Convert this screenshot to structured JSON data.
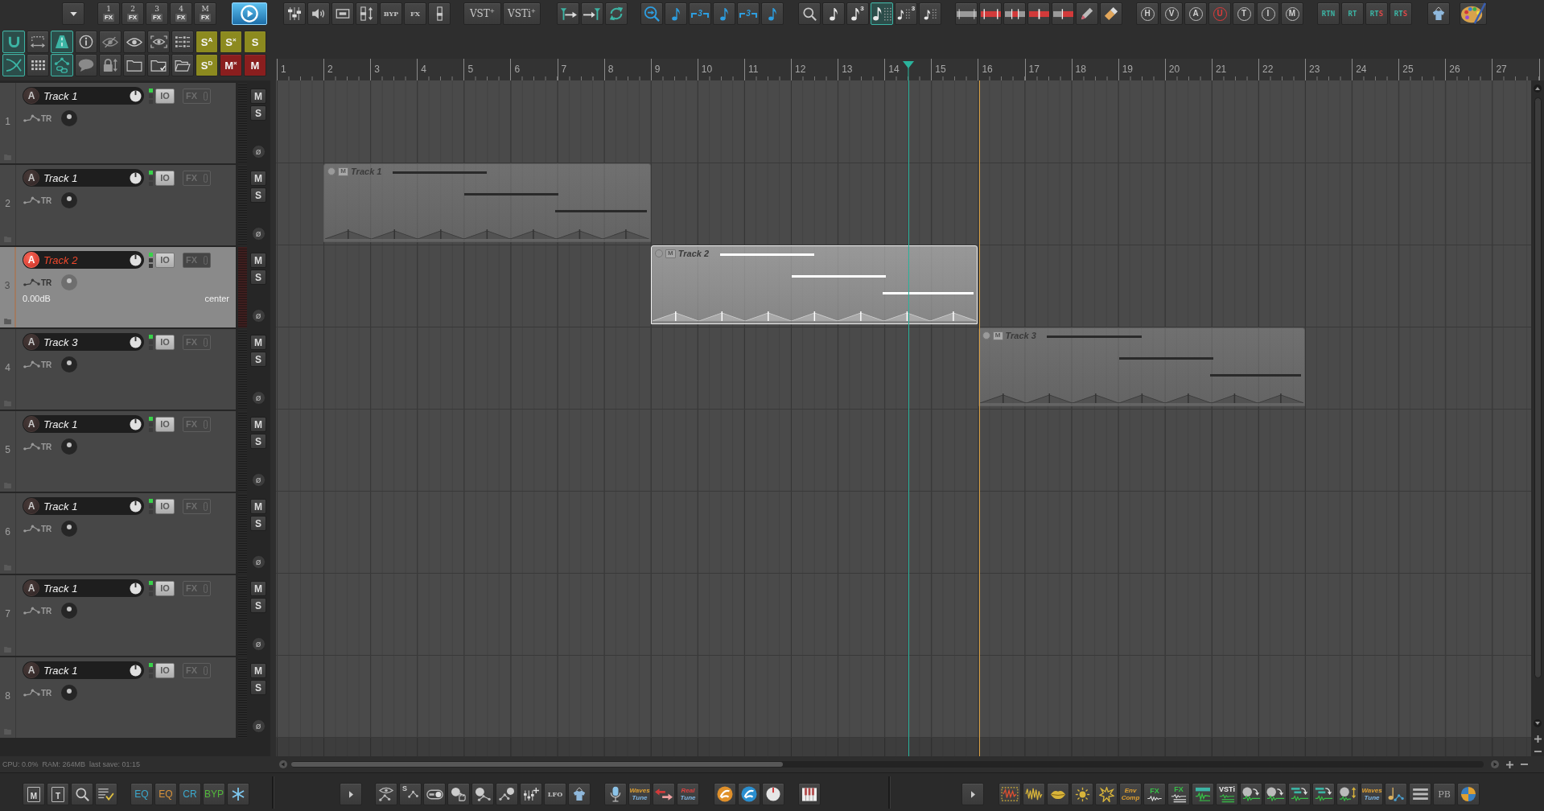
{
  "main_toolbar": {
    "groups": [
      [
        {
          "on": false
        }
      ],
      [
        {
          "number": "1",
          "label": "FX",
          "on": false
        },
        {
          "number": "2",
          "label": "FX",
          "on": false
        },
        {
          "number": "3",
          "label": "FX",
          "on": false
        },
        {
          "number": "4",
          "label": "FX",
          "on": false
        },
        {
          "number": "M",
          "label": "FX",
          "on": false
        }
      ],
      [
        {
          "on": true
        }
      ],
      [
        {
          "on": false
        },
        {
          "on": false
        },
        {
          "on": false
        },
        {
          "on": false
        },
        {
          "label": "BYP",
          "on": false
        },
        {
          "label": "FX",
          "on": false
        },
        {
          "on": false
        }
      ],
      [
        {
          "label": "VST$^{+}$",
          "on": false
        },
        {
          "label": "VSTi$^{+}$",
          "on": false
        }
      ],
      [
        {
          "on": false
        },
        {
          "on": false
        },
        {
          "on": false
        }
      ],
      [
        {
          "on": false
        },
        {
          "on": false
        },
        {
          "label": "3",
          "on": false
        },
        {
          "on": false
        },
        {
          "label": "3",
          "on": false
        },
        {
          "on": false
        }
      ],
      [
        {
          "on": false
        },
        {
          "on": false
        },
        {
          "label": "3",
          "on": false
        },
        {
          "on": true
        },
        {
          "label": "3",
          "on": false
        },
        {
          "on": false
        }
      ],
      [
        {
          "on": false
        },
        {
          "on": false
        },
        {
          "on": false
        },
        {
          "on": false
        },
        {
          "on": false
        },
        {
          "on": false
        },
        {
          "on": false
        }
      ],
      [
        {
          "label": "H",
          "on": false
        },
        {
          "label": "V",
          "on": false
        },
        {
          "label": "A",
          "on": false
        },
        {
          "label": "U",
          "on": true
        },
        {
          "label": "T",
          "on": false
        },
        {
          "label": "I",
          "on": false
        },
        {
          "label": "M",
          "on": false
        }
      ],
      [
        {
          "label": "RTN",
          "on": false
        },
        {
          "label": "RT",
          "on": false
        },
        {
          "label": "RT",
          "suffix": "S",
          "on": false
        },
        {
          "label": "RT",
          "suffix": "S",
          "on": false
        }
      ],
      [
        {
          "on": false
        }
      ],
      [
        {
          "on": false
        }
      ]
    ]
  },
  "left_toolbar": {
    "rows": [
      [
        {
          "on": true
        },
        {
          "on": false
        },
        {
          "on": true
        },
        {
          "on": false
        },
        {
          "on": false
        },
        {
          "on": false
        },
        {
          "on": false
        },
        {
          "on": false
        },
        {
          "label": "S$^{A}$",
          "color": "#8c8a1f",
          "on": false
        },
        {
          "label": "S$^{×}$",
          "color": "#8c8a1f",
          "on": false
        },
        {
          "label": "S",
          "color": "#8c8a1f",
          "on": false
        }
      ],
      [
        {
          "on": true
        },
        {
          "on": false
        },
        {
          "on": true
        },
        {
          "on": false
        },
        {
          "on": false
        },
        {
          "on": false
        },
        {
          "on": false
        },
        {
          "on": false
        },
        {
          "label": "S$^{D}$",
          "color": "#8c8a1f",
          "on": false
        },
        {
          "label": "M$^{×}$",
          "color": "#8a1e1e",
          "on": false
        },
        {
          "label": "M",
          "color": "#8a1e1e",
          "on": false
        }
      ]
    ]
  },
  "ruler": {
    "bars": [
      "1",
      "2",
      "3",
      "4",
      "5",
      "6",
      "7",
      "8",
      "9",
      "10",
      "11",
      "12",
      "13",
      "14",
      "15",
      "16",
      "17",
      "18",
      "19",
      "20",
      "21",
      "22",
      "23",
      "24",
      "25",
      "26",
      "27"
    ]
  },
  "tracks": [
    {
      "number": "1",
      "arm": "A",
      "name": "Track 1",
      "io": "IO",
      "fx": "FX",
      "envelope": "TR",
      "mute": "M",
      "solo": "S",
      "phase": "ø",
      "selected": false,
      "armed": false
    },
    {
      "number": "2",
      "arm": "A",
      "name": "Track 1",
      "io": "IO",
      "fx": "FX",
      "envelope": "TR",
      "mute": "M",
      "solo": "S",
      "phase": "ø",
      "selected": false,
      "armed": false
    },
    {
      "number": "3",
      "arm": "A",
      "name": "Track 2",
      "io": "IO",
      "fx": "FX",
      "envelope": "TR",
      "volume": "0.00dB",
      "pan": "center",
      "mute": "M",
      "solo": "S",
      "phase": "ø",
      "selected": true,
      "armed": true
    },
    {
      "number": "4",
      "arm": "A",
      "name": "Track 3",
      "io": "IO",
      "fx": "FX",
      "envelope": "TR",
      "mute": "M",
      "solo": "S",
      "phase": "ø",
      "selected": false,
      "armed": false
    },
    {
      "number": "5",
      "arm": "A",
      "name": "Track 1",
      "io": "IO",
      "fx": "FX",
      "envelope": "TR",
      "mute": "M",
      "solo": "S",
      "phase": "ø",
      "selected": false,
      "armed": false
    },
    {
      "number": "6",
      "arm": "A",
      "name": "Track 1",
      "io": "IO",
      "fx": "FX",
      "envelope": "TR",
      "mute": "M",
      "solo": "S",
      "phase": "ø",
      "selected": false,
      "armed": false
    },
    {
      "number": "7",
      "arm": "A",
      "name": "Track 1",
      "io": "IO",
      "fx": "FX",
      "envelope": "TR",
      "mute": "M",
      "solo": "S",
      "phase": "ø",
      "selected": false,
      "armed": false
    },
    {
      "number": "8",
      "arm": "A",
      "name": "Track 1",
      "io": "IO",
      "fx": "FX",
      "envelope": "TR",
      "mute": "M",
      "solo": "S",
      "phase": "ø",
      "selected": false,
      "armed": false
    }
  ],
  "arrange": {
    "items": [
      {
        "title": "Track 1",
        "mute": "M",
        "selected": false
      },
      {
        "title": "Track 2",
        "mute": "M",
        "selected": true
      },
      {
        "title": "Track 3",
        "mute": "M",
        "selected": false
      }
    ]
  },
  "status_bar": {
    "text": "CPU: 0.0%  RAM: 264MB  last save: 01:15"
  },
  "bottom_toolbar": {
    "groups": [
      [
        {
          "label": "M",
          "on": false
        },
        {
          "label": "T",
          "on": false
        },
        {
          "on": false
        },
        {
          "on": false
        }
      ],
      [
        {
          "label": "EQ",
          "color": "#3aa8cc",
          "on": false
        },
        {
          "label": "EQ",
          "color": "#d8923a",
          "on": false
        },
        {
          "label": "CR",
          "color": "#3aa8cc",
          "on": false
        },
        {
          "label": "BYP",
          "color": "#52b83a",
          "on": false
        },
        {
          "on": false
        }
      ],
      [
        {
          "on": false
        }
      ],
      [
        {
          "on": false
        },
        {
          "label": "S",
          "on": false
        },
        {
          "on": false
        },
        {
          "on": false
        },
        {
          "on": false
        },
        {
          "on": false
        },
        {
          "on": false
        },
        {
          "label": "LFO",
          "on": false
        },
        {
          "on": false
        }
      ],
      [
        {
          "on": false
        },
        {
          "lines": [
            "Waves",
            "Tune"
          ],
          "on": false
        },
        {
          "on": false
        },
        {
          "lines": [
            "Real",
            "Tune"
          ],
          "on": false
        }
      ],
      [
        {
          "on": false
        },
        {
          "on": false
        },
        {
          "on": false
        }
      ],
      [
        {
          "on": false
        }
      ],
      [
        {
          "on": false
        }
      ],
      [
        {
          "on": false
        },
        {
          "on": false
        },
        {
          "on": false
        },
        {
          "on": false
        },
        {
          "on": false
        },
        {
          "lines": [
            "Env",
            "Comp"
          ],
          "on": false
        },
        {
          "label": "FX",
          "on": false
        },
        {
          "label": "FX",
          "on": false
        },
        {
          "on": false
        },
        {
          "label": "VSTi",
          "on": false
        },
        {
          "on": false
        },
        {
          "on": false
        },
        {
          "on": false
        },
        {
          "on": false
        },
        {
          "on": false
        },
        {
          "lines": [
            "Waves",
            "Tune"
          ],
          "on": false
        },
        {
          "on": false
        },
        {
          "on": false
        },
        {
          "label": "PB",
          "on": false
        },
        {
          "on": false
        }
      ]
    ]
  }
}
